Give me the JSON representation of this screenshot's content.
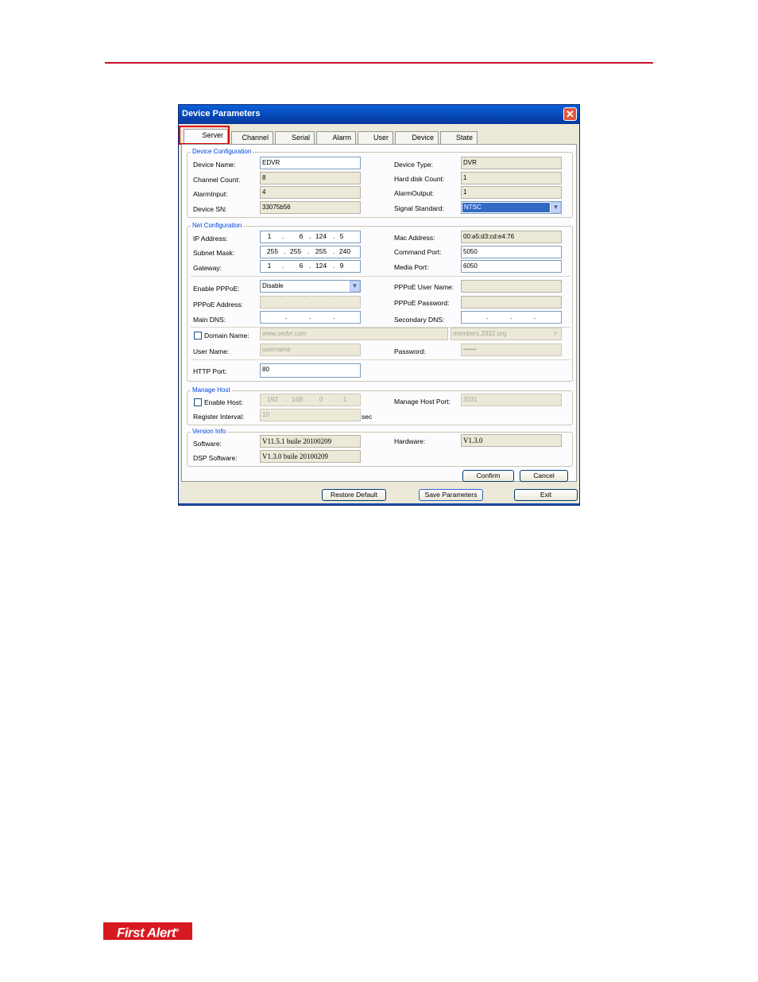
{
  "window": {
    "title": "Device Parameters",
    "close_label": "✕"
  },
  "tabs": [
    {
      "label": "Server"
    },
    {
      "label": "Channel"
    },
    {
      "label": "Serial"
    },
    {
      "label": "Alarm"
    },
    {
      "label": "User"
    },
    {
      "label": "Device"
    },
    {
      "label": "State"
    }
  ],
  "device_config": {
    "title": "Device Configuration",
    "device_name_label": "Device Name:",
    "device_name": "EDVR",
    "device_type_label": "Device Type:",
    "device_type": "DVR",
    "channel_count_label": "Channel Count:",
    "channel_count": "8",
    "hard_disk_count_label": "Hard disk Count:",
    "hard_disk_count": "1",
    "alarm_input_label": "AlarmInput:",
    "alarm_input": "4",
    "alarm_output_label": "AlarmOutput:",
    "alarm_output": "1",
    "device_sn_label": "Device SN:",
    "device_sn": "33075b56",
    "signal_standard_label": "Signal Standard:",
    "signal_standard": "NTSC"
  },
  "net_config": {
    "title": "Net Configuration",
    "ip_label": "IP Address:",
    "ip": [
      "1",
      "6",
      "124",
      "5"
    ],
    "mac_label": "Mac Address:",
    "mac": "00:a5:d3:cd:e4:76",
    "subnet_label": "Subnet Mask:",
    "subnet": [
      "255",
      "255",
      "255",
      "240"
    ],
    "command_port_label": "Command Port:",
    "command_port": "5050",
    "gateway_label": "Gateway:",
    "gateway": [
      "1",
      "6",
      "124",
      "9"
    ],
    "media_port_label": "Media Port:",
    "media_port": "6050",
    "pppoe_label": "Enable PPPoE:",
    "pppoe": "Disable",
    "pppoe_user_label": "PPPoE User Name:",
    "pppoe_user": "",
    "pppoe_address_label": "PPPoE Address:",
    "pppoe_password_label": "PPPoE Password:",
    "pppoe_password": "",
    "main_dns_label": "Main DNS:",
    "secondary_dns_label": "Secondary DNS:",
    "domain_name_label": "Domain Name:",
    "domain_name": "www.sedvr.com",
    "domain_server": "members.3322.org",
    "user_name_label": "User Name:",
    "user_name": "username",
    "password_label": "Password:",
    "password": "••••••",
    "http_port_label": "HTTP Port:",
    "http_port": "80"
  },
  "manage_host": {
    "title": "Manage Host",
    "enable_host_label": "Enable Host:",
    "host_ip": [
      "192",
      "168",
      "0",
      "1"
    ],
    "manage_host_port_label": "Manage Host Port:",
    "manage_host_port": "3031",
    "register_interval_label": "Register Interval:",
    "register_interval": "10",
    "register_interval_unit": "sec"
  },
  "version_info": {
    "title": "Version Info",
    "software_label": "Software:",
    "software": "V11.5.1 buile 20100209",
    "hardware_label": "Hardware:",
    "hardware": "V1.3.0",
    "dsp_label": "DSP Software:",
    "dsp": "V1.3.0 buile 20100209"
  },
  "buttons": {
    "confirm": "Confirm",
    "cancel": "Cancel",
    "restore_default": "Restore Default",
    "save_parameters": "Save Parameters",
    "exit": "Exit"
  },
  "footer": {
    "logo_text": "First Alert",
    "logo_mark": "®"
  },
  "colors": {
    "accent_rule": "#c8102e",
    "highlight_box": "#e00000",
    "logo_red": "#d71920"
  }
}
